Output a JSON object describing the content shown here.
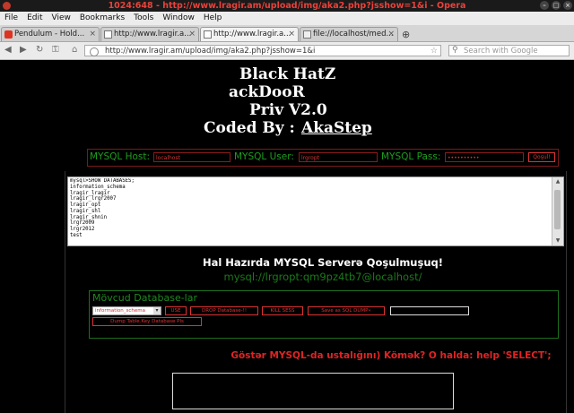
{
  "window": {
    "title": "1024:648 - http://www.lragir.am/upload/img/aka2.php?jsshow=1&i - Opera"
  },
  "menu": [
    "File",
    "Edit",
    "View",
    "Bookmarks",
    "Tools",
    "Window",
    "Help"
  ],
  "tabs": [
    {
      "label": "Pendulum - Hold...",
      "favicon": "youtube-icon"
    },
    {
      "label": "http://www.lragir.a...",
      "favicon": "page-icon"
    },
    {
      "label": "http://www.lragir.a...",
      "favicon": "page-icon",
      "active": true
    },
    {
      "label": "file://localhost/med...",
      "favicon": "file-icon"
    }
  ],
  "address": {
    "url": "http://www.lragir.am/upload/img/aka2.php?jsshow=1&i",
    "search_placeholder": "Search with Google"
  },
  "logo": {
    "line1": "Black HatZ",
    "line2": "ackDooR",
    "line3": "Priv V2.0",
    "line4_prefix": "Coded By :",
    "line4_name": "AkaStep"
  },
  "connection": {
    "host_label": "MYSQL Host:",
    "host_value": "localhost",
    "user_label": "MYSQL User:",
    "user_value": "lrgropt",
    "pass_label": "MYSQL Pass:",
    "pass_value": "••••••••••",
    "submit_label": "Qoşul!"
  },
  "console": {
    "lines": [
      "mysql>SHOW DATABASES;",
      "information_schema",
      "lragir_lragir",
      "lragir_lrgr2007",
      "lragir_opt",
      "lragir_shl",
      "lragir_shnin",
      "lrgr2009",
      "lrgr2012",
      "test"
    ]
  },
  "status": {
    "connected": "Hal Hazırda MYSQL Serverə Qoşulmuşuq!",
    "user": "mysql://lrgropt:qm9pz4tb7@localhost/"
  },
  "databases": {
    "legend": "Mövcud Database-lar",
    "selected": "information_schema",
    "buttons": [
      "USE",
      "DROP Database-!!",
      "KILL SESS",
      "Save as  SQL DUMP«",
      "Dump Table.Key Database Pls"
    ]
  },
  "help_text": "Göstər MYSQL-da ustalığını) Kömək? O halda: help 'SELECT';",
  "colors": {
    "accent_red": "#dd3333",
    "accent_green": "#1e9e1e",
    "background": "#000000"
  }
}
